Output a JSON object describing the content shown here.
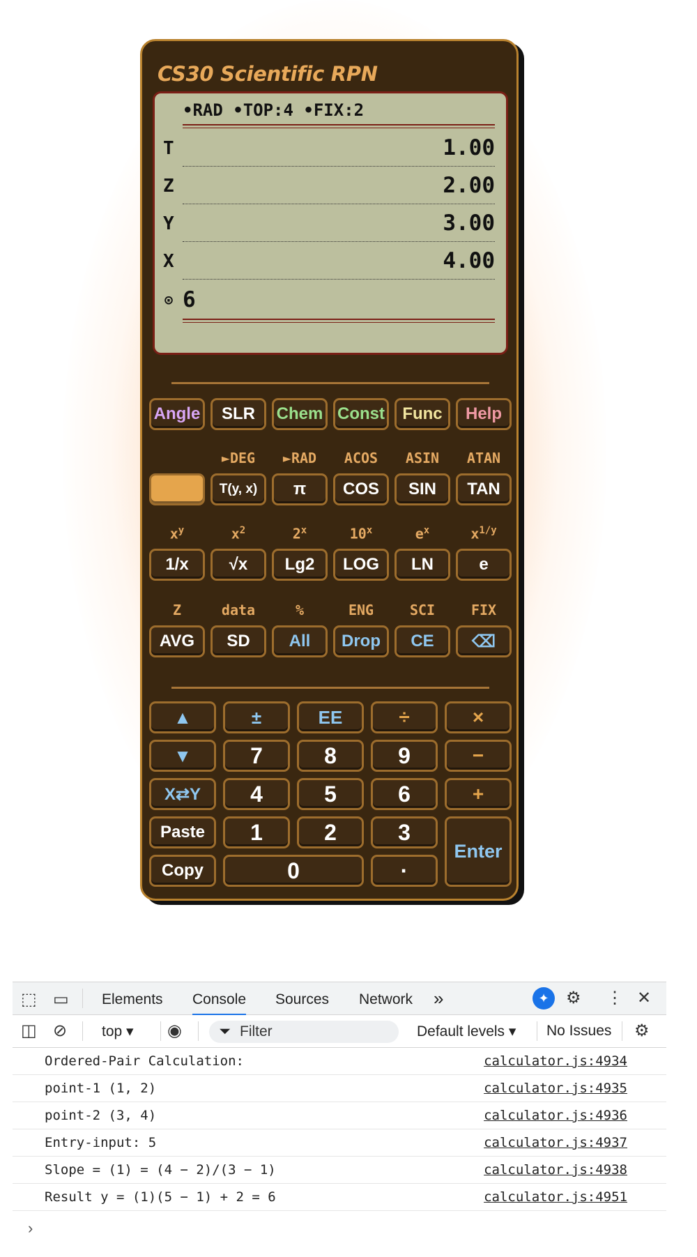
{
  "calculator": {
    "title": "CS30 Scientific RPN",
    "status": "•RAD •TOP:4 •FIX:2",
    "registers": [
      {
        "label": "T",
        "value": "1.00"
      },
      {
        "label": "Z",
        "value": "2.00"
      },
      {
        "label": "Y",
        "value": "3.00"
      },
      {
        "label": "X",
        "value": "4.00"
      }
    ],
    "entry_icon": "⊙",
    "entry_value": "6",
    "menu_keys": [
      "Angle",
      "SLR",
      "Chem",
      "Const",
      "Func",
      "Help"
    ],
    "menu_colors": [
      "#d8a6f5",
      "#ffffff",
      "#9be08c",
      "#9be08c",
      "#f2e6a0",
      "#f09aa5"
    ],
    "row1_alt": [
      "",
      "►DEG",
      "►RAD",
      "ACOS",
      "ASIN",
      "ATAN"
    ],
    "row1_keys": [
      "",
      "T(y, x)",
      "π",
      "COS",
      "SIN",
      "TAN"
    ],
    "row2_alt_base": [
      "x",
      "x",
      "2",
      "10",
      "e",
      "x"
    ],
    "row2_alt_sup": [
      "y",
      "2",
      "x",
      "x",
      "x",
      "1/y"
    ],
    "row2_keys": [
      "1/x",
      "√x",
      "Lg2",
      "LOG",
      "LN",
      "e"
    ],
    "row3_alt": [
      "Z",
      "data",
      "%",
      "ENG",
      "SCI",
      "FIX"
    ],
    "row3_keys": [
      "AVG",
      "SD",
      "All",
      "Drop",
      "CE",
      "⌫"
    ],
    "keypad": {
      "up": "▲",
      "plusminus": "±",
      "ee": "EE",
      "divide": "÷",
      "multiply": "×",
      "down": "▼",
      "seven": "7",
      "eight": "8",
      "nine": "9",
      "minus": "−",
      "swap": "X⇄Y",
      "four": "4",
      "five": "5",
      "six": "6",
      "plus": "+",
      "paste": "Paste",
      "one": "1",
      "two": "2",
      "three": "3",
      "enter": "Enter",
      "copy": "Copy",
      "zero": "0",
      "dot": "·"
    },
    "colors": {
      "body": "#3a2710",
      "accent": "#e5a54c",
      "blue_key": "#8fc7f0",
      "shift": "#e5a54c"
    }
  },
  "devtools": {
    "tabs": [
      "Elements",
      "Console",
      "Sources",
      "Network"
    ],
    "active_tab": "Console",
    "more": "»",
    "context": "top ▾",
    "filter_placeholder": "Filter",
    "levels": "Default levels ▾",
    "issues": "No Issues",
    "logs": [
      {
        "message": "Ordered-Pair Calculation:",
        "source": "calculator.js:4934"
      },
      {
        "message": "point-1 (1, 2)",
        "source": "calculator.js:4935"
      },
      {
        "message": "point-2 (3, 4)",
        "source": "calculator.js:4936"
      },
      {
        "message": "Entry-input: 5",
        "source": "calculator.js:4937"
      },
      {
        "message": "Slope = (1) = (4 − 2)/(3 − 1)",
        "source": "calculator.js:4938"
      },
      {
        "message": "Result y = (1)(5 − 1) + 2 = 6",
        "source": "calculator.js:4951"
      }
    ],
    "prompt": "›"
  }
}
